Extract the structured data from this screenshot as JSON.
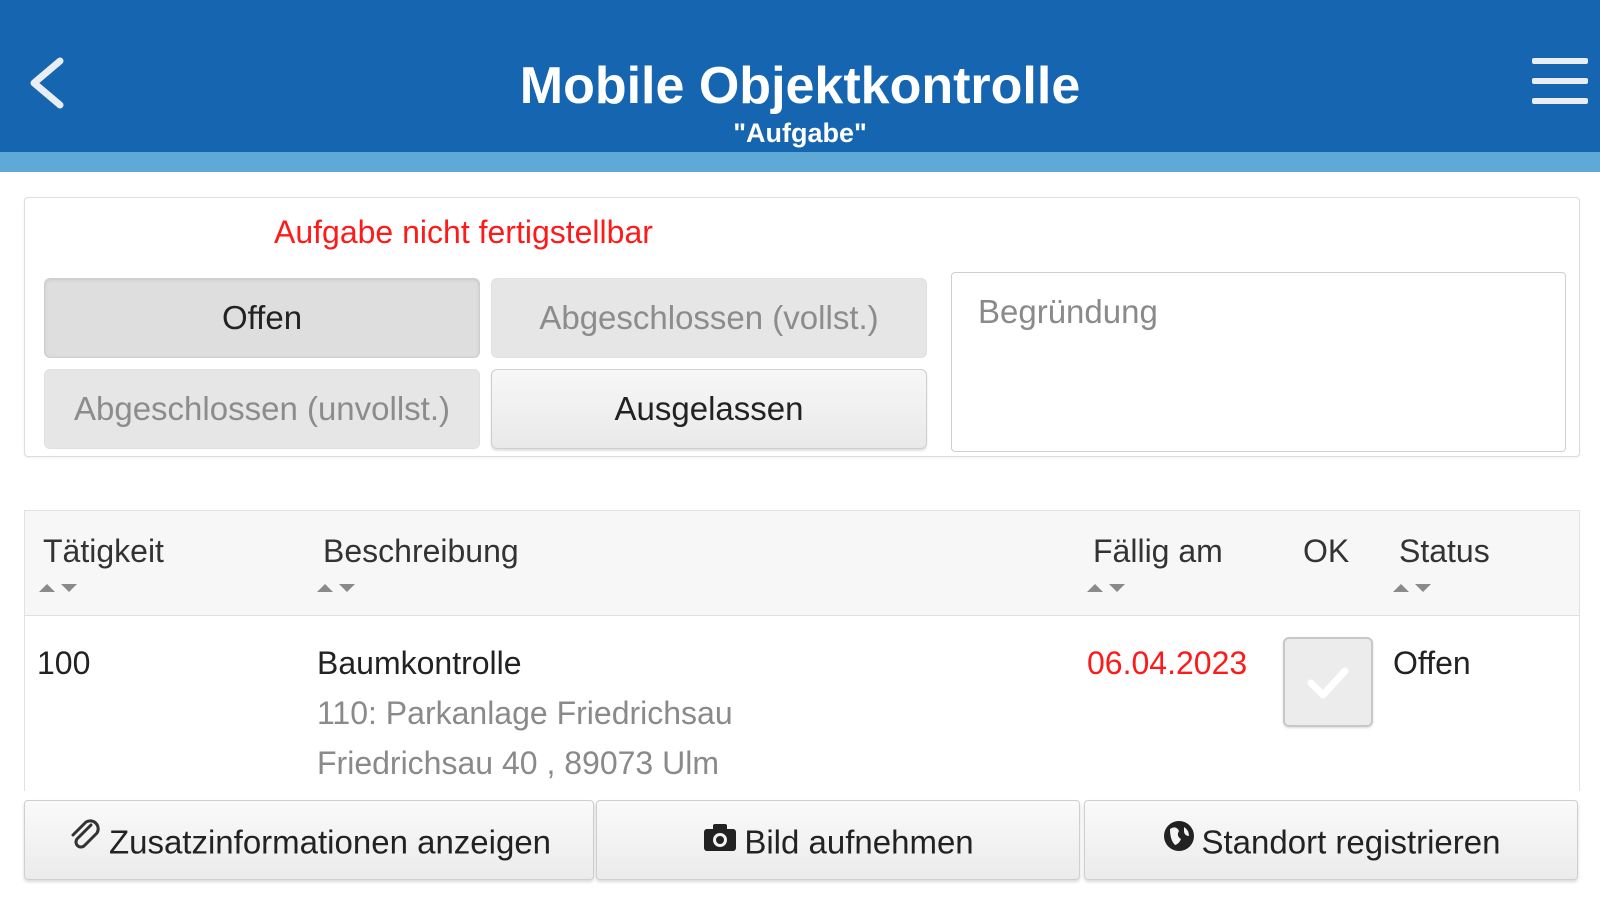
{
  "header": {
    "title": "Mobile Objektkontrolle",
    "subtitle": "\"Aufgabe\"",
    "back_icon": "chevron-left-icon",
    "menu_icon": "hamburger-menu-icon",
    "bg_color": "#1565b0",
    "stripe_color": "#5ea9d6"
  },
  "status_panel": {
    "warning": "Aufgabe nicht fertigstellbar",
    "warning_color": "#ff1a1a",
    "buttons": {
      "offen": "Offen",
      "abgeschlossen_vollst": "Abgeschlossen (vollst.)",
      "abgeschlossen_unvollst": "Abgeschlossen (unvollst.)",
      "ausgelassen": "Ausgelassen"
    },
    "selected": "Offen",
    "reason_placeholder": "Begründung",
    "reason_value": ""
  },
  "table": {
    "columns": {
      "taetigkeit": "Tätigkeit",
      "beschreibung": "Beschreibung",
      "faellig": "Fällig am",
      "ok": "OK",
      "status": "Status"
    },
    "rows": [
      {
        "taetigkeit": "100",
        "beschreibung": "Baumkontrolle",
        "detail1": "110: Parkanlage Friedrichsau",
        "detail2": "Friedrichsau 40 , 89073 Ulm",
        "faellig": "06.04.2023",
        "faellig_color": "#ff1a1a",
        "ok": false,
        "status": "Offen"
      }
    ]
  },
  "footer": {
    "info_label": "Zusatzinformationen anzeigen",
    "info_icon": "paperclip-icon",
    "photo_label": "Bild aufnehmen",
    "photo_icon": "camera-icon",
    "location_label": "Standort registrieren",
    "location_icon": "globe-icon"
  }
}
